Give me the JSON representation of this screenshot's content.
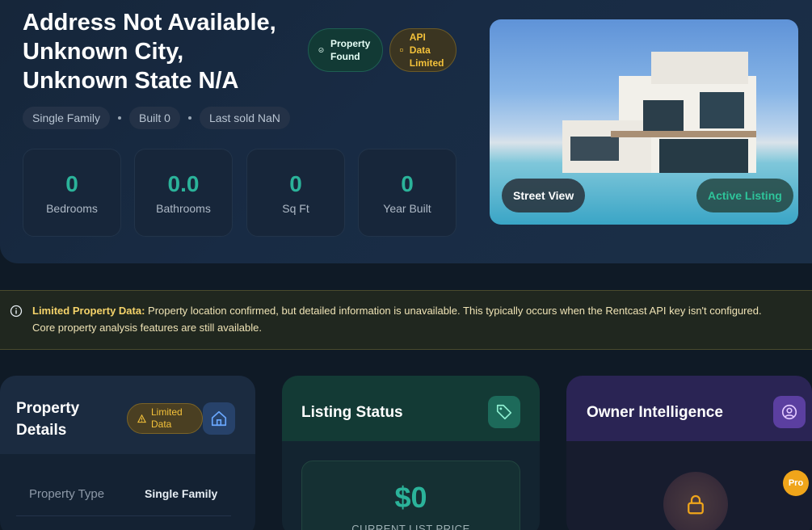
{
  "hero": {
    "title_line1": "Address Not Available,",
    "title_line2": "Unknown City,",
    "title_line3": "Unknown State N/A",
    "badges": {
      "found": "Property Found",
      "api": "API Data Limited"
    },
    "chips": {
      "type": "Single Family",
      "built": "Built 0",
      "sold": "Last sold NaN"
    },
    "stats": [
      {
        "value": "0",
        "label": "Bedrooms"
      },
      {
        "value": "0.0",
        "label": "Bathrooms"
      },
      {
        "value": "0",
        "label": "Sq Ft"
      },
      {
        "value": "0",
        "label": "Year Built"
      }
    ],
    "photo": {
      "street_view_label": "Street View",
      "status_label": "Active Listing"
    }
  },
  "alert": {
    "title": "Limited Property Data:",
    "message": "Property location confirmed, but detailed information is unavailable. This typically occurs when the Rentcast API key isn't configured. Core property analysis features are still available."
  },
  "cards": {
    "details": {
      "title": "Property Details",
      "badge": "Limited Data",
      "row": {
        "key": "Property Type",
        "value": "Single Family"
      }
    },
    "listing": {
      "title": "Listing Status",
      "price": "$0",
      "price_label": "CURRENT LIST PRICE"
    },
    "owner": {
      "title": "Owner Intelligence",
      "pro_badge": "Pro"
    }
  },
  "colors": {
    "accent_green": "#2bb39a",
    "warning_yellow": "#f3c13a",
    "pro_orange": "#f0a51a"
  },
  "icons": {
    "found": "check-circle-icon",
    "api": "square-dot-icon",
    "alert": "info-icon",
    "details": "home-icon",
    "listing": "tag-icon",
    "owner": "user-circle-icon",
    "owner_lock": "lock-icon"
  }
}
